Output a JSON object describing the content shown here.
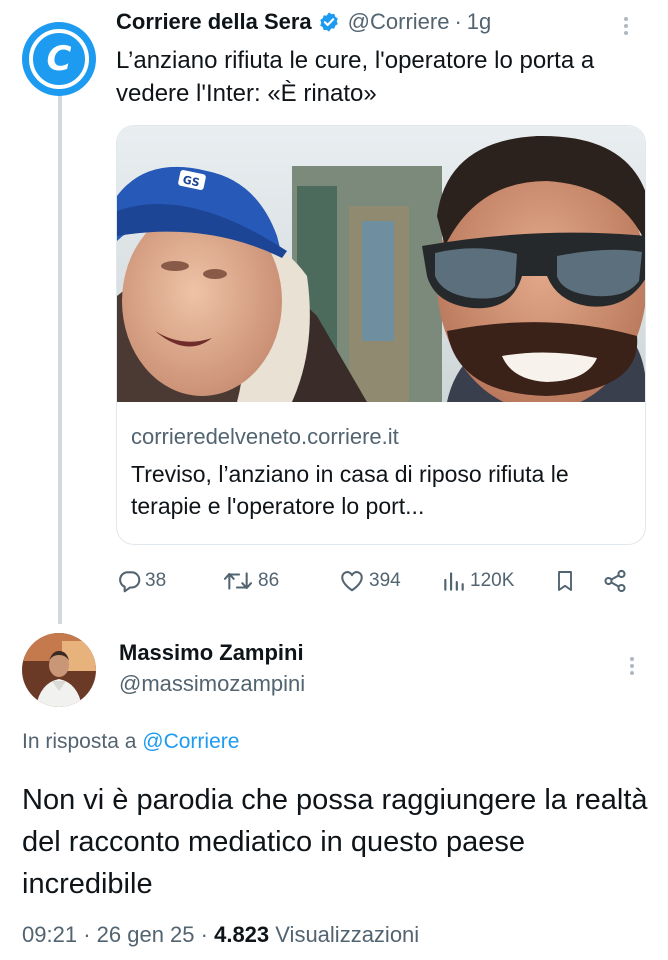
{
  "quoted_tweet": {
    "author_name": "Corriere della Sera",
    "handle": "@Corriere",
    "separator": "·",
    "time": "1g",
    "text": "L’anziano rifiuta le cure, l'operatore lo porta a vedere l'Inter: «È rinato»",
    "avatar_letter": "C",
    "card": {
      "domain": "corrieredelveneto.corriere.it",
      "title": "Treviso, l’anziano in casa di riposo rifiuta le terapie e l'operatore lo port...",
      "cap_logo_text": "GS"
    },
    "actions": {
      "replies": "38",
      "retweets": "86",
      "likes": "394",
      "views": "120K"
    }
  },
  "reply_tweet": {
    "author_name": "Massimo Zampini",
    "handle": "@massimozampini",
    "reply_prefix": "In risposta a",
    "reply_mention": "@Corriere",
    "text": "Non vi è parodia che possa raggiungere la realtà del racconto mediatico in questo paese incredibile",
    "time": "09:21",
    "date": "26 gen 25",
    "dot": "·",
    "views_count": "4.823",
    "views_label": "Visualizzazioni"
  },
  "colors": {
    "accent": "#1d9bf0",
    "secondary_text": "#536471",
    "primary_text": "#0f1419",
    "thread_line": "#cfd9de"
  },
  "icons": [
    "verified-badge-icon",
    "more-options-icon",
    "reply-icon",
    "retweet-icon",
    "like-icon",
    "views-icon",
    "bookmark-icon",
    "share-icon"
  ]
}
